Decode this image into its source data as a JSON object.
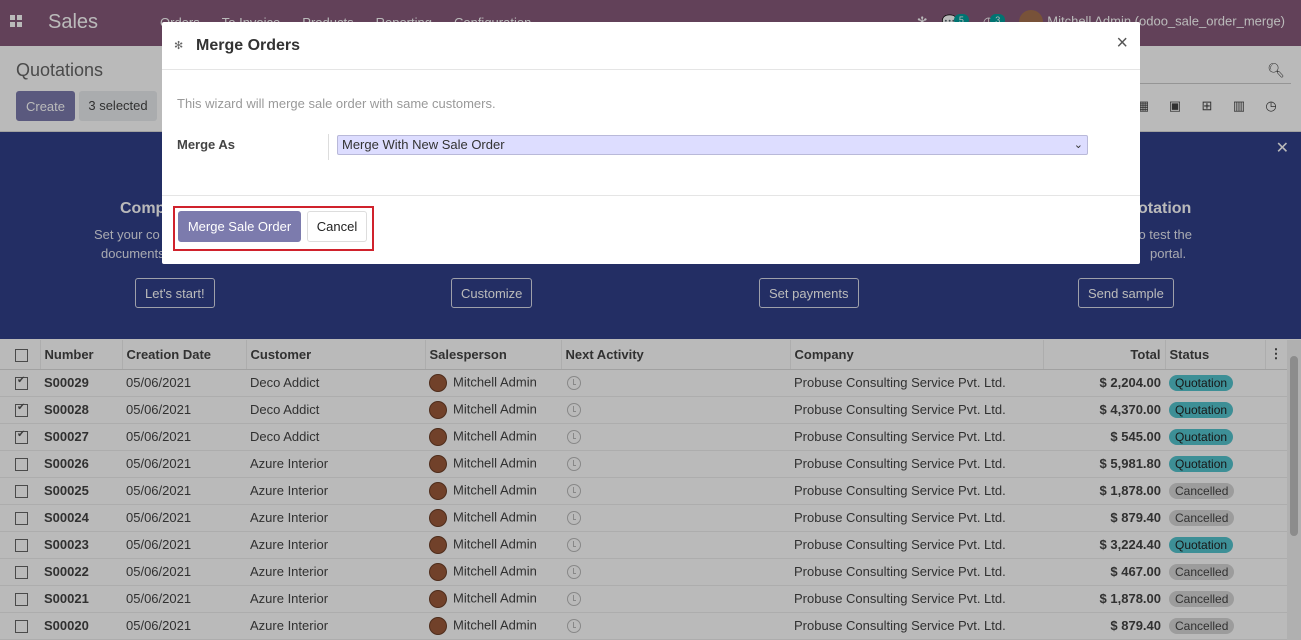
{
  "navbar": {
    "brand": "Sales",
    "menu": [
      "Orders",
      "To Invoice",
      "Products",
      "Reporting",
      "Configuration"
    ],
    "messages_count": "5",
    "activities_count": "3",
    "user": "Mitchell Admin (odoo_sale_order_merge)"
  },
  "control": {
    "title": "Quotations",
    "create_label": "Create",
    "selected_label": "3 selected"
  },
  "banner": {
    "columns": [
      {
        "title": "Comp",
        "desc1": "Set your co",
        "desc2": "documents",
        "button": "Let's start!"
      },
      {
        "title": "",
        "desc1": "",
        "desc2": "",
        "button": "Customize"
      },
      {
        "title": "",
        "desc1": "",
        "desc2": "",
        "button": "Set payments"
      },
      {
        "title": "otation",
        "desc1": "n to test the",
        "desc2": "portal.",
        "button": "Send sample"
      }
    ]
  },
  "table": {
    "headers": [
      "Number",
      "Creation Date",
      "Customer",
      "Salesperson",
      "Next Activity",
      "Company",
      "Total",
      "Status"
    ],
    "rows": [
      {
        "checked": true,
        "number": "S00029",
        "date": "05/06/2021",
        "customer": "Deco Addict",
        "salesperson": "Mitchell Admin",
        "company": "Probuse Consulting Service Pvt. Ltd.",
        "total": "$ 2,204.00",
        "status": "Quotation"
      },
      {
        "checked": true,
        "number": "S00028",
        "date": "05/06/2021",
        "customer": "Deco Addict",
        "salesperson": "Mitchell Admin",
        "company": "Probuse Consulting Service Pvt. Ltd.",
        "total": "$ 4,370.00",
        "status": "Quotation"
      },
      {
        "checked": true,
        "number": "S00027",
        "date": "05/06/2021",
        "customer": "Deco Addict",
        "salesperson": "Mitchell Admin",
        "company": "Probuse Consulting Service Pvt. Ltd.",
        "total": "$ 545.00",
        "status": "Quotation"
      },
      {
        "checked": false,
        "number": "S00026",
        "date": "05/06/2021",
        "customer": "Azure Interior",
        "salesperson": "Mitchell Admin",
        "company": "Probuse Consulting Service Pvt. Ltd.",
        "total": "$ 5,981.80",
        "status": "Quotation"
      },
      {
        "checked": false,
        "number": "S00025",
        "date": "05/06/2021",
        "customer": "Azure Interior",
        "salesperson": "Mitchell Admin",
        "company": "Probuse Consulting Service Pvt. Ltd.",
        "total": "$ 1,878.00",
        "status": "Cancelled"
      },
      {
        "checked": false,
        "number": "S00024",
        "date": "05/06/2021",
        "customer": "Azure Interior",
        "salesperson": "Mitchell Admin",
        "company": "Probuse Consulting Service Pvt. Ltd.",
        "total": "$ 879.40",
        "status": "Cancelled"
      },
      {
        "checked": false,
        "number": "S00023",
        "date": "05/06/2021",
        "customer": "Azure Interior",
        "salesperson": "Mitchell Admin",
        "company": "Probuse Consulting Service Pvt. Ltd.",
        "total": "$ 3,224.40",
        "status": "Quotation"
      },
      {
        "checked": false,
        "number": "S00022",
        "date": "05/06/2021",
        "customer": "Azure Interior",
        "salesperson": "Mitchell Admin",
        "company": "Probuse Consulting Service Pvt. Ltd.",
        "total": "$ 467.00",
        "status": "Cancelled"
      },
      {
        "checked": false,
        "number": "S00021",
        "date": "05/06/2021",
        "customer": "Azure Interior",
        "salesperson": "Mitchell Admin",
        "company": "Probuse Consulting Service Pvt. Ltd.",
        "total": "$ 1,878.00",
        "status": "Cancelled"
      },
      {
        "checked": false,
        "number": "S00020",
        "date": "05/06/2021",
        "customer": "Azure Interior",
        "salesperson": "Mitchell Admin",
        "company": "Probuse Consulting Service Pvt. Ltd.",
        "total": "$ 879.40",
        "status": "Cancelled"
      }
    ]
  },
  "modal": {
    "title": "Merge Orders",
    "hint": "This wizard will merge sale order with same customers.",
    "merge_as_label": "Merge As",
    "merge_as_value": "Merge With New Sale Order",
    "merge_button": "Merge Sale Order",
    "cancel_button": "Cancel"
  },
  "colors": {
    "navbar": "#875a7b",
    "primary": "#7c7bad",
    "banner": "#303f8a",
    "quotation_badge": "#54c4ce",
    "highlight": "#d0222c"
  }
}
